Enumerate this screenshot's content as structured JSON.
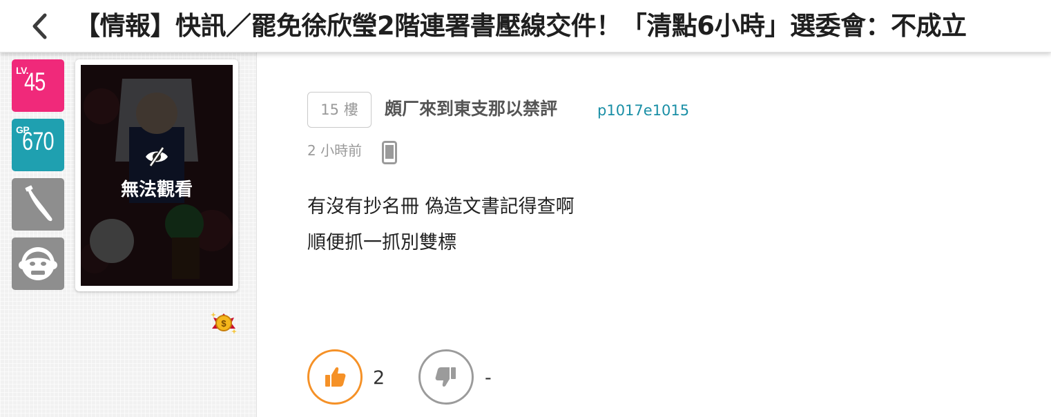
{
  "header": {
    "title": "【情報】快訊／罷免徐欣瑩2階連署書壓線交件！「清點6小時」選委會：不成立"
  },
  "author_panel": {
    "level": {
      "tag": "LV.",
      "value": "45",
      "color": "#f0297a"
    },
    "gp": {
      "tag": "GP",
      "value": "670",
      "color": "#1fa0b0"
    },
    "badges": [
      "knife-icon",
      "monkey-face-icon"
    ],
    "avatar_caption": "無法觀看",
    "medal": "gold-coin-medal-icon"
  },
  "post": {
    "floor": "15 樓",
    "author_name": "頗厂來到東支那以禁評",
    "author_id": "p1017e1015",
    "time": "2 小時前",
    "device": "mobile-phone-icon",
    "content_lines": [
      "有沒有抄名冊 偽造文書記得查啊",
      "順便抓一抓別雙標"
    ],
    "gp_count": "2",
    "bp_count": "-"
  },
  "colors": {
    "like": "#f59127",
    "dislike": "#9b9b9b",
    "author_id": "#1a8fa6"
  }
}
